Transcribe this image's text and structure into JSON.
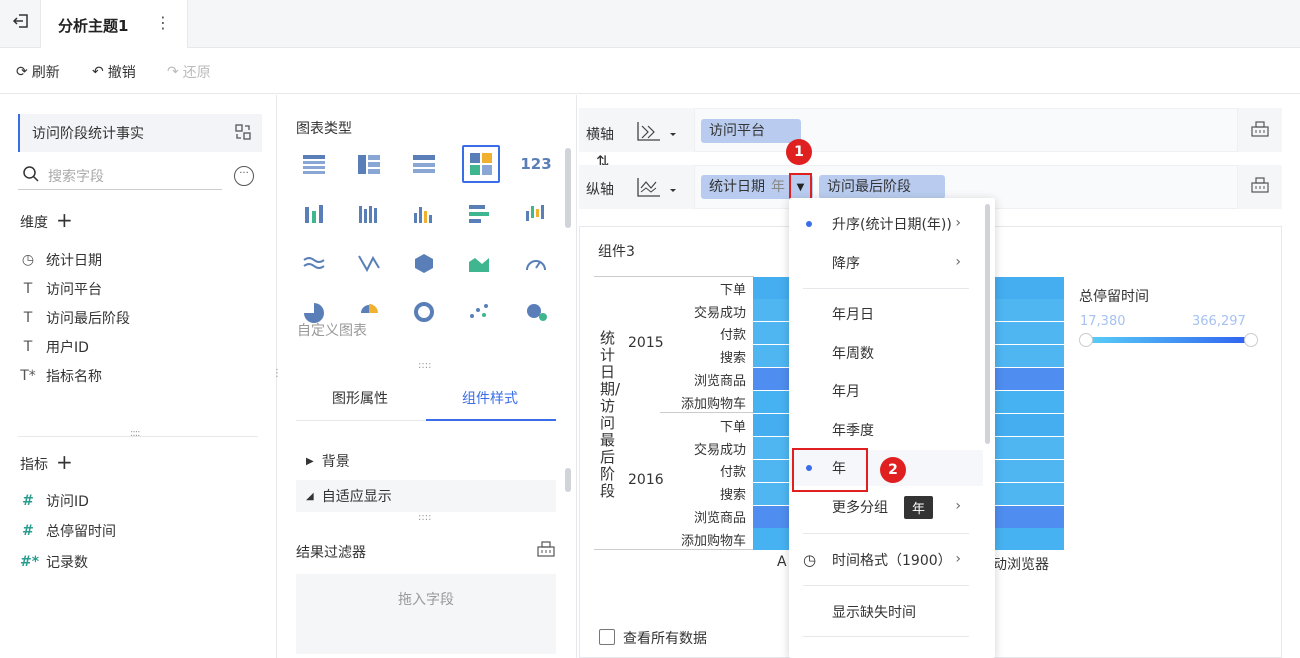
{
  "tab": {
    "title": "分析主题1"
  },
  "toolbar": {
    "refresh": "刷新",
    "undo": "撤销",
    "redo": "还原"
  },
  "left": {
    "dataset": "访问阶段统计事实",
    "search_placeholder": "搜索字段",
    "dimension_label": "维度",
    "dimensions": [
      "统计日期",
      "访问平台",
      "访问最后阶段",
      "用户ID",
      "指标名称"
    ],
    "measure_label": "指标",
    "measures": [
      "访问ID",
      "总停留时间",
      "记录数"
    ]
  },
  "middle": {
    "chart_type_label": "图表类型",
    "custom_chart": "自定义图表",
    "tab_graphic": "图形属性",
    "tab_style": "组件样式",
    "bg_label": "背景",
    "adaptive_label": "自适应显示",
    "filter_label": "结果过滤器",
    "drop_hint": "拖入字段"
  },
  "axes": {
    "x_label": "横轴",
    "y_label": "纵轴",
    "x_field": "访问平台",
    "y_field1": "统计日期",
    "y_field1_sub": "年",
    "y_field2": "访问最后阶段"
  },
  "chart": {
    "component": "组件3",
    "y_axis_title": "统计日期/访问最后阶段",
    "groups": [
      {
        "year": "2015",
        "rows": [
          "下单",
          "交易成功",
          "付款",
          "搜索",
          "浏览商品",
          "添加购物车"
        ]
      },
      {
        "year": "2016",
        "rows": [
          "下单",
          "交易成功",
          "付款",
          "搜索",
          "浏览商品",
          "添加购物车"
        ]
      }
    ],
    "x_left_label": "A",
    "x_right_label": "动浏览器",
    "legend_title": "总停留时间",
    "legend_min": "17,380",
    "legend_max": "366,297",
    "view_all": "查看所有数据"
  },
  "menu": {
    "asc": "升序(统计日期(年))",
    "desc": "降序",
    "ymd": "年月日",
    "yw": "年周数",
    "ym": "年月",
    "yq": "年季度",
    "y": "年",
    "more": "更多分组",
    "more_tag": "年",
    "time_fmt": "时间格式（1900）",
    "show_missing": "显示缺失时间"
  },
  "badges": {
    "one": "1",
    "two": "2"
  },
  "colors": {
    "accent": "#3a6ee8",
    "pill": "#b9ccf0",
    "bar": "#4fb6f2",
    "red": "#e02020"
  }
}
